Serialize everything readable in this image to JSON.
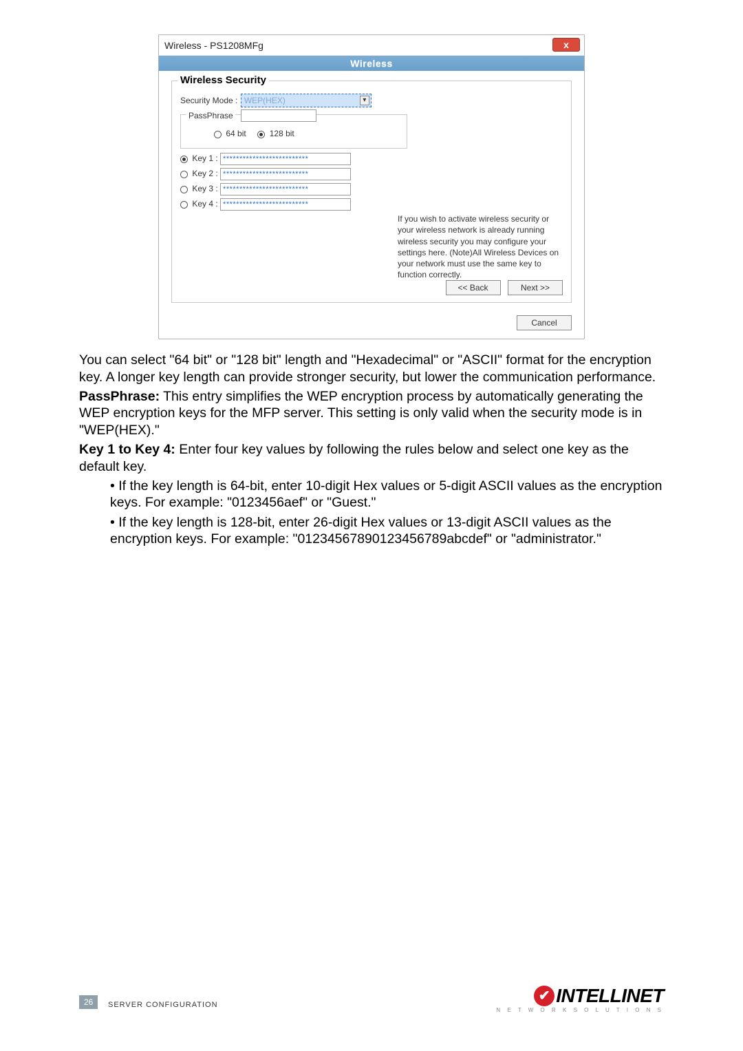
{
  "dialog": {
    "title": "Wireless - PS1208MFg",
    "close_glyph": "x",
    "tab": "Wireless",
    "section_title": "Wireless Security",
    "security_mode_label": "Security Mode :",
    "security_mode_value": "WEP(HEX)",
    "help_text": "If you wish to activate wireless security or your wireless network is already running wireless security you may configure your settings here. (Note)All Wireless Devices on your network must use the same key to function correctly.",
    "passphrase_label": "PassPhrase",
    "bit64": "64 bit",
    "bit128": "128 bit",
    "keys": [
      {
        "label": "Key 1 :",
        "value": "**************************",
        "checked": true
      },
      {
        "label": "Key 2 :",
        "value": "**************************",
        "checked": false
      },
      {
        "label": "Key 3 :",
        "value": "**************************",
        "checked": false
      },
      {
        "label": "Key 4 :",
        "value": "**************************",
        "checked": false
      }
    ],
    "back": "<< Back",
    "next": "Next >>",
    "cancel": "Cancel"
  },
  "doc": {
    "para1": "You can select \"64 bit\" or \"128 bit\" length and \"Hexadecimal\" or \"ASCII\" format for the encryption key. A longer key length can provide stronger security, but lower the communication performance.",
    "passphrase_label": "PassPhrase:",
    "passphrase_text": " This entry simplifies the WEP encryption process by automatically generating the WEP encryption keys for the MFP server. This setting is only valid when the security mode is in \"WEP(HEX).\"",
    "keys_label": "Key 1 to Key 4:",
    "keys_text": " Enter four key values by following the rules below and select one key as the default key.",
    "bullet1": "• If the key length is 64-bit, enter 10-digit Hex values or 5-digit ASCII values as the encryption keys. For example: \"0123456aef\" or \"Guest.\"",
    "bullet2": "• If the key length is 128-bit, enter 26-digit Hex values or 13-digit ASCII values as the encryption keys. For example: \"01234567890123456789abcdef\" or \"administrator.\""
  },
  "footer": {
    "page": "26",
    "section": "SERVER CONFIGURATION",
    "logo_text": "INTELLINET",
    "logo_sub": "N E T W O R K   S O L U T I O N S",
    "check": "✔"
  }
}
